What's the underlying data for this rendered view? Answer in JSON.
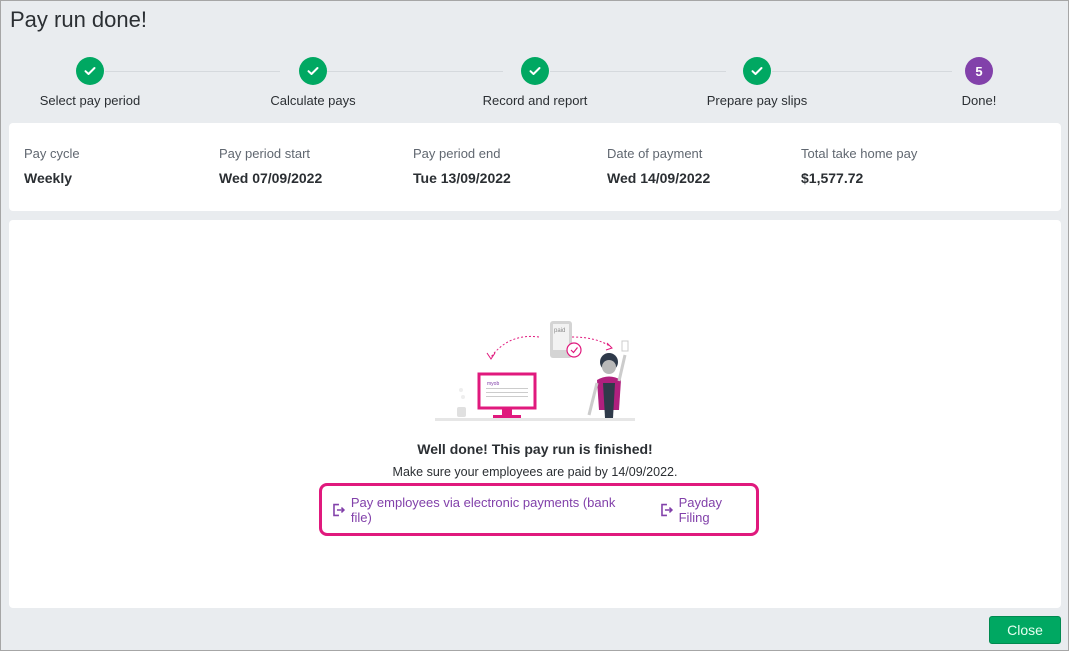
{
  "page": {
    "title": "Pay run done!"
  },
  "stepper": {
    "steps": [
      {
        "label": "Select pay period",
        "state": "done",
        "icon": "check-icon"
      },
      {
        "label": "Calculate pays",
        "state": "done",
        "icon": "check-icon"
      },
      {
        "label": "Record and report",
        "state": "done",
        "icon": "check-icon"
      },
      {
        "label": "Prepare pay slips",
        "state": "done",
        "icon": "check-icon"
      },
      {
        "label": "Done!",
        "state": "current",
        "number": "5"
      }
    ]
  },
  "summary": {
    "pay_cycle": {
      "label": "Pay cycle",
      "value": "Weekly"
    },
    "period_start": {
      "label": "Pay period start",
      "value": "Wed 07/09/2022"
    },
    "period_end": {
      "label": "Pay period end",
      "value": "Tue 13/09/2022"
    },
    "payment_date": {
      "label": "Date of payment",
      "value": "Wed 14/09/2022"
    },
    "take_home": {
      "label": "Total take home pay",
      "value": "$1,577.72"
    }
  },
  "main": {
    "illustration": {
      "paid_text": "paid",
      "brand_text": "myob"
    },
    "heading": "Well done! This pay run is finished!",
    "subtext": "Make sure your employees are paid by 14/09/2022.",
    "links": [
      {
        "label": "Pay employees via electronic payments (bank file)",
        "icon": "export-icon"
      },
      {
        "label": "Payday Filing",
        "icon": "export-icon"
      }
    ]
  },
  "footer": {
    "close_label": "Close"
  },
  "colors": {
    "success": "#00a862",
    "brand_purple": "#8241aa",
    "highlight": "#e0197d"
  }
}
